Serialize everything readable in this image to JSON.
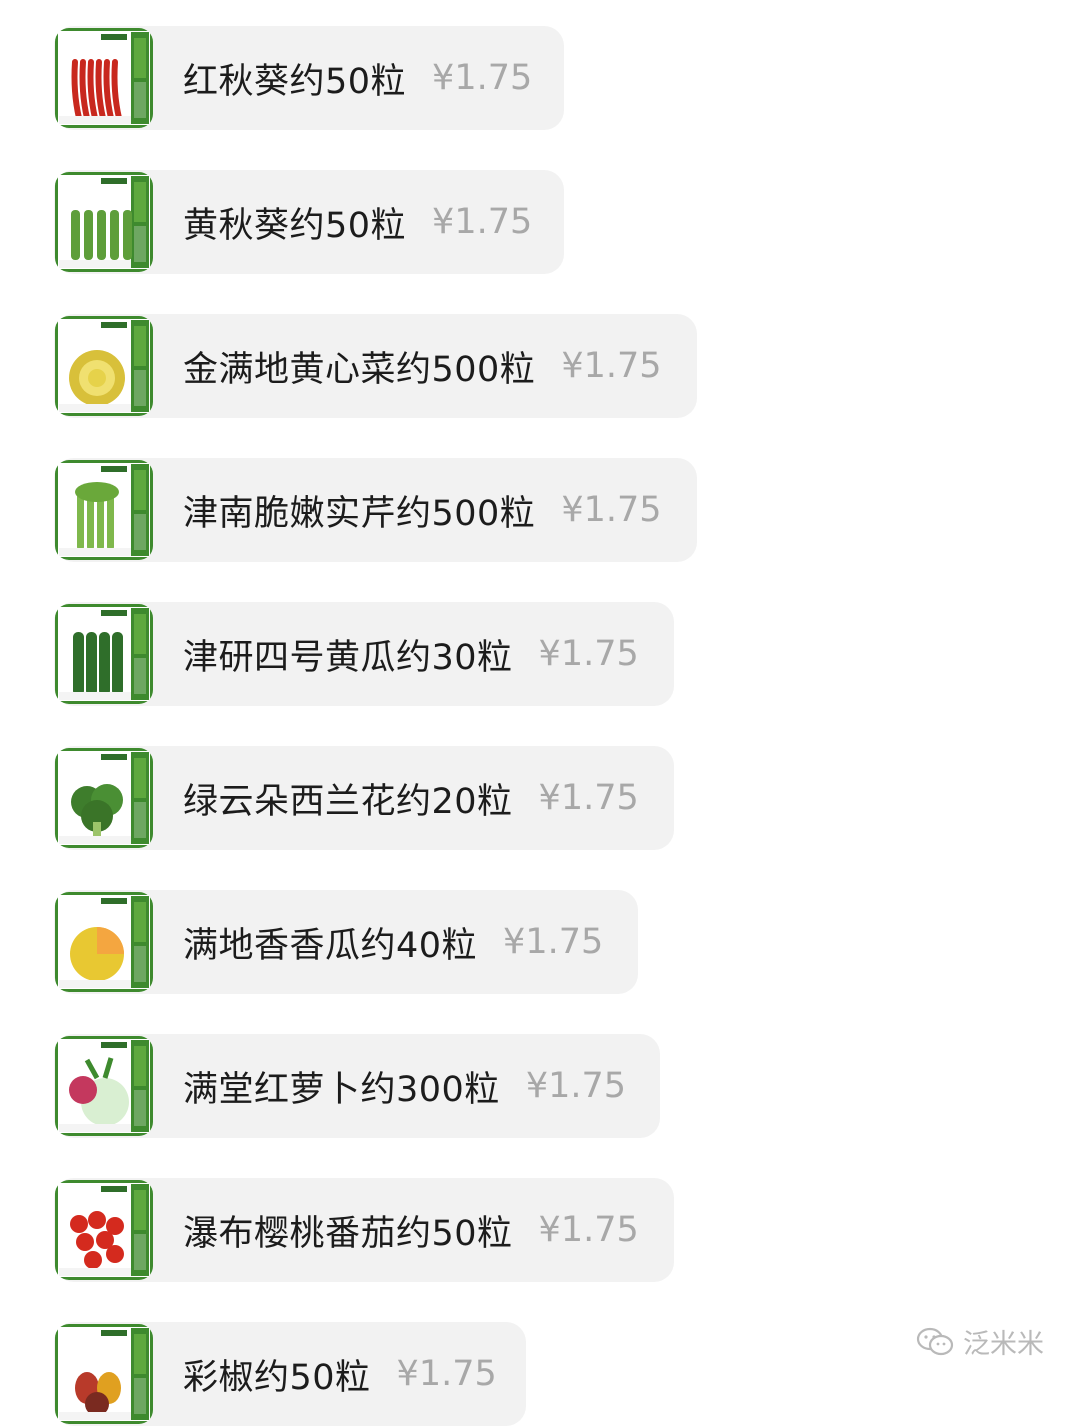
{
  "products": [
    {
      "name": "红秋葵约50粒",
      "price": "¥1.75",
      "thumb_icon": "red-okra-seed-packet-icon",
      "pack_title": "红秋葵",
      "accent": "#c8281e"
    },
    {
      "name": "黄秋葵约50粒",
      "price": "¥1.75",
      "thumb_icon": "green-okra-seed-packet-icon",
      "pack_title": "黄秋葵",
      "accent": "#5e9e3a"
    },
    {
      "name": "金满地黄心菜约500粒",
      "price": "¥1.75",
      "thumb_icon": "yellow-cabbage-seed-packet-icon",
      "pack_title": "金满地黄心菜",
      "accent": "#d8c03a"
    },
    {
      "name": "津南脆嫩实芹约500粒",
      "price": "¥1.75",
      "thumb_icon": "celery-seed-packet-icon",
      "pack_title": "津南脆嫩实芹",
      "accent": "#7fb84c"
    },
    {
      "name": "津研四号黄瓜约30粒",
      "price": "¥1.75",
      "thumb_icon": "cucumber-seed-packet-icon",
      "pack_title": "津研四号黄瓜",
      "accent": "#2f6e2a"
    },
    {
      "name": "绿云朵西兰花约20粒",
      "price": "¥1.75",
      "thumb_icon": "broccoli-seed-packet-icon",
      "pack_title": "绿云朵西兰花",
      "accent": "#3e7d2c"
    },
    {
      "name": "满地香香瓜约40粒",
      "price": "¥1.75",
      "thumb_icon": "melon-seed-packet-icon",
      "pack_title": "满地香香瓜",
      "accent": "#e8c832"
    },
    {
      "name": "满堂红萝卜约300粒",
      "price": "¥1.75",
      "thumb_icon": "radish-seed-packet-icon",
      "pack_title": "满堂红萝卜",
      "accent": "#c4385e"
    },
    {
      "name": "瀑布樱桃番茄约50粒",
      "price": "¥1.75",
      "thumb_icon": "cherry-tomato-seed-packet-icon",
      "pack_title": "瀑布樱桃番茄",
      "accent": "#d42a1e"
    },
    {
      "name": "彩椒约50粒",
      "price": "¥1.75",
      "thumb_icon": "bell-pepper-seed-packet-icon",
      "pack_title": "彩椒",
      "accent": "#b83a2a"
    }
  ],
  "watermark": {
    "text": "泛米米",
    "icon": "wechat-channel-icon"
  }
}
